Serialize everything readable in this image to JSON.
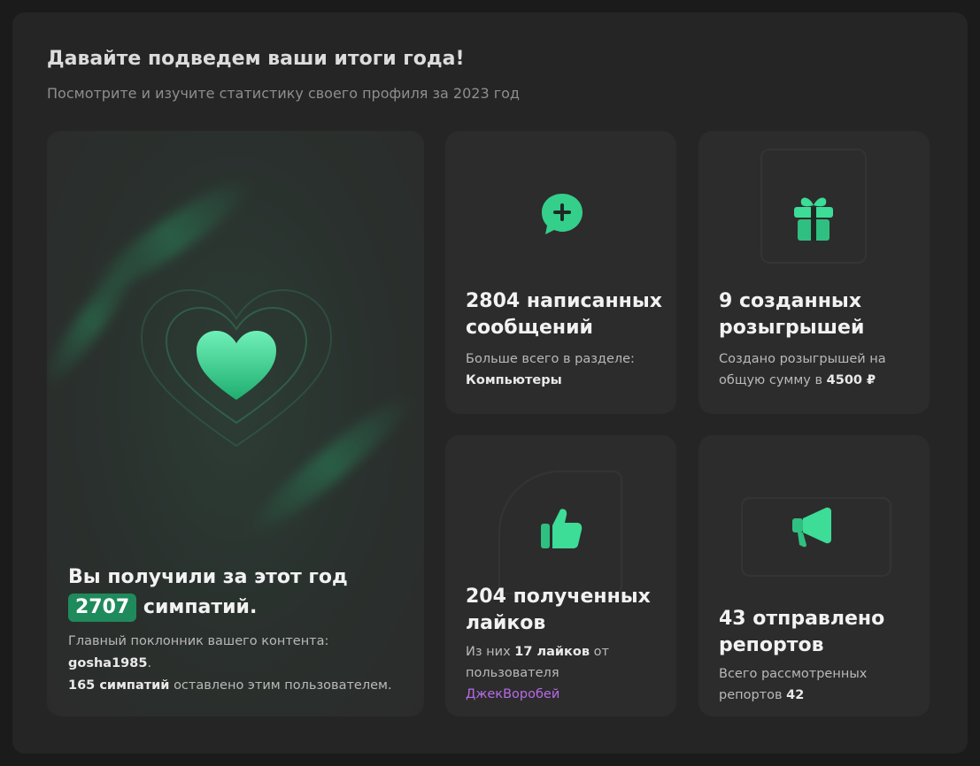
{
  "header": {
    "title": "Давайте подведем ваши итоги года!",
    "subtitle": "Посмотрите и изучите статистику своего профиля за 2023 год"
  },
  "likes_card": {
    "title_before": "Вы получили за этот год",
    "count": "2707",
    "title_after": "симпатий.",
    "desc_prefix": "Главный поклонник вашего контента:",
    "top_fan": "gosha1985",
    "top_fan_suffix": ".",
    "fan_likes": "165 симпатий",
    "fan_likes_suffix": "оставлено этим пользователем.",
    "icon": "heart-icon"
  },
  "messages_card": {
    "title": "2804 написанных сообщений",
    "desc_prefix": "Больше всего в разделе:",
    "section": "Компьютеры",
    "icon": "chat-plus-icon"
  },
  "giveaways_card": {
    "title": "9 созданных розыгрышей",
    "desc_prefix": "Создано розыгрышей на общую сумму в",
    "amount": "4500 ₽",
    "icon": "gift-icon"
  },
  "received_likes_card": {
    "title": "204 полученных лайков",
    "desc_prefix": "Из них",
    "likes_from_user": "17 лайков",
    "desc_mid": "от пользователя",
    "user": "ДжекВоробей",
    "icon": "thumbs-up-icon"
  },
  "reports_card": {
    "title": "43 отправлено репортов",
    "desc_prefix": "Всего рассмотренных репортов",
    "reviewed": "42",
    "icon": "megaphone-icon"
  },
  "colors": {
    "accent": "#1f8a5b",
    "icon_green": "#3ddc97",
    "link": "#b86be6"
  }
}
